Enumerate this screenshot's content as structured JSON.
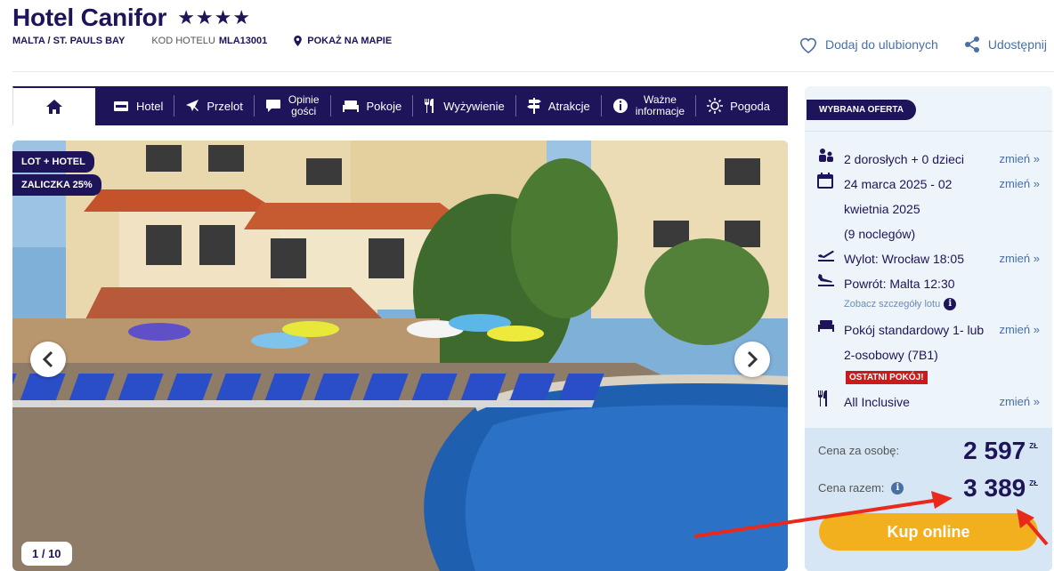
{
  "header": {
    "hotel_name": "Hotel Canifor",
    "stars": "★★★★",
    "location": "MALTA / ST. PAULS BAY",
    "code_label": "KOD HOTELU",
    "code_value": "MLA13001",
    "map_label": "POKAŻ NA MAPIE",
    "favorite_label": "Dodaj do ulubionych",
    "share_label": "Udostępnij"
  },
  "tabs": [
    {
      "label": "Hotel",
      "icon": "hotel-icon"
    },
    {
      "label": "Przelot",
      "icon": "plane-icon"
    },
    {
      "label": "Opinie gości",
      "line1": "Opinie",
      "line2": "gości",
      "icon": "chat-icon"
    },
    {
      "label": "Pokoje",
      "icon": "bed-icon"
    },
    {
      "label": "Wyżywienie",
      "icon": "cutlery-icon"
    },
    {
      "label": "Atrakcje",
      "icon": "signpost-icon"
    },
    {
      "label": "Ważne informacje",
      "line1": "Ważne",
      "line2": "informacje",
      "icon": "info-icon"
    },
    {
      "label": "Pogoda",
      "icon": "sun-icon"
    }
  ],
  "gallery": {
    "badge_1": "LOT + HOTEL",
    "badge_2": "ZALICZKA 25%",
    "counter": "1 / 10"
  },
  "offer": {
    "badge": "WYBRANA OFERTA",
    "travelers": "2 dorosłych + 0 dzieci",
    "dates_line1": "24 marca 2025 - 02",
    "dates_line2": "kwietnia 2025",
    "nights": "(9 noclegów)",
    "departure": "Wylot: Wrocław 18:05",
    "return": "Powrót: Malta 12:30",
    "flight_details": "Zobacz szczegóły lotu",
    "room_line1": "Pokój standardowy 1- lub",
    "room_line2": "2-osobowy (7B1)",
    "last_rooms": "OSTATNI POKÓJ!",
    "board": "All Inclusive",
    "change_label": "zmień »",
    "price_per_person_label": "Cena za osobę:",
    "price_per_person": "2 597",
    "total_label": "Cena razem:",
    "total_price": "3 389",
    "currency": "ZŁ",
    "buy_label": "Kup online"
  },
  "colors": {
    "navy": "#1e1459",
    "accent_yellow": "#f2b01e",
    "link_blue": "#4a6fa5",
    "alert_red": "#cc1a1a"
  }
}
